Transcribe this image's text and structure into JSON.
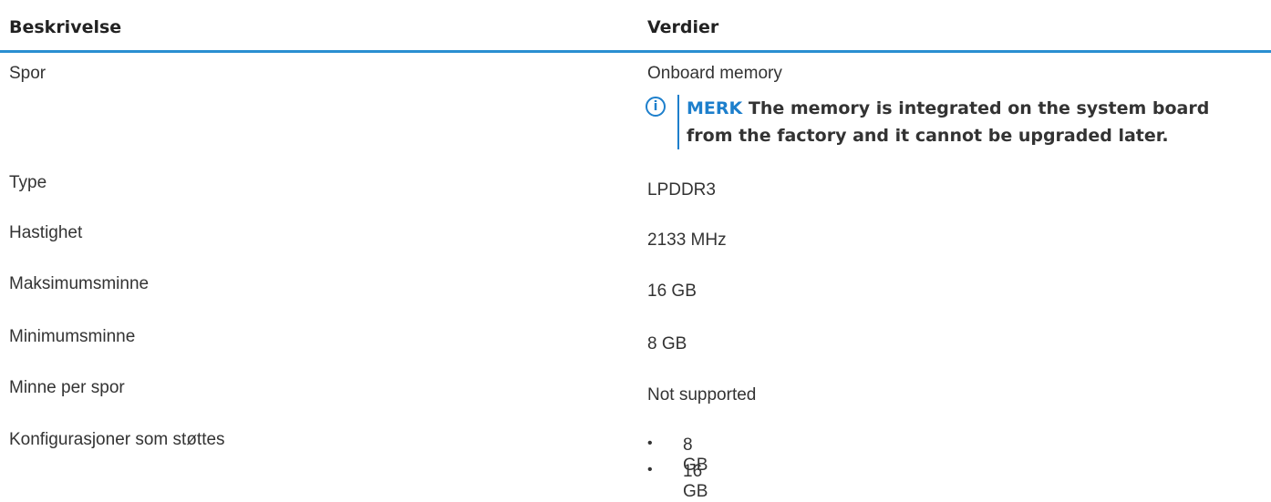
{
  "table": {
    "headers": [
      "Beskrivelse",
      "Verdier"
    ],
    "rows": [
      {
        "label": "Spor",
        "value": "Onboard memory"
      },
      {
        "label": "Type",
        "value": "LPDDR3"
      },
      {
        "label": "Hastighet",
        "value": "2133 MHz"
      },
      {
        "label": "Maksimumsminne",
        "value": "16 GB"
      },
      {
        "label": "Minimumsminne",
        "value": "8 GB"
      },
      {
        "label": "Minne per spor",
        "value": "Not supported"
      },
      {
        "label": "Konfigurasjoner som støttes",
        "values": [
          "8 GB",
          "16 GB"
        ]
      }
    ]
  },
  "note": {
    "icon": "info-icon",
    "label": "MERK",
    "text": "The memory is integrated on the system board from the factory and it cannot be upgraded later."
  },
  "colors": {
    "accent": "#1d7fcc",
    "header_rule": "#2a8fd1",
    "text": "#333333"
  }
}
